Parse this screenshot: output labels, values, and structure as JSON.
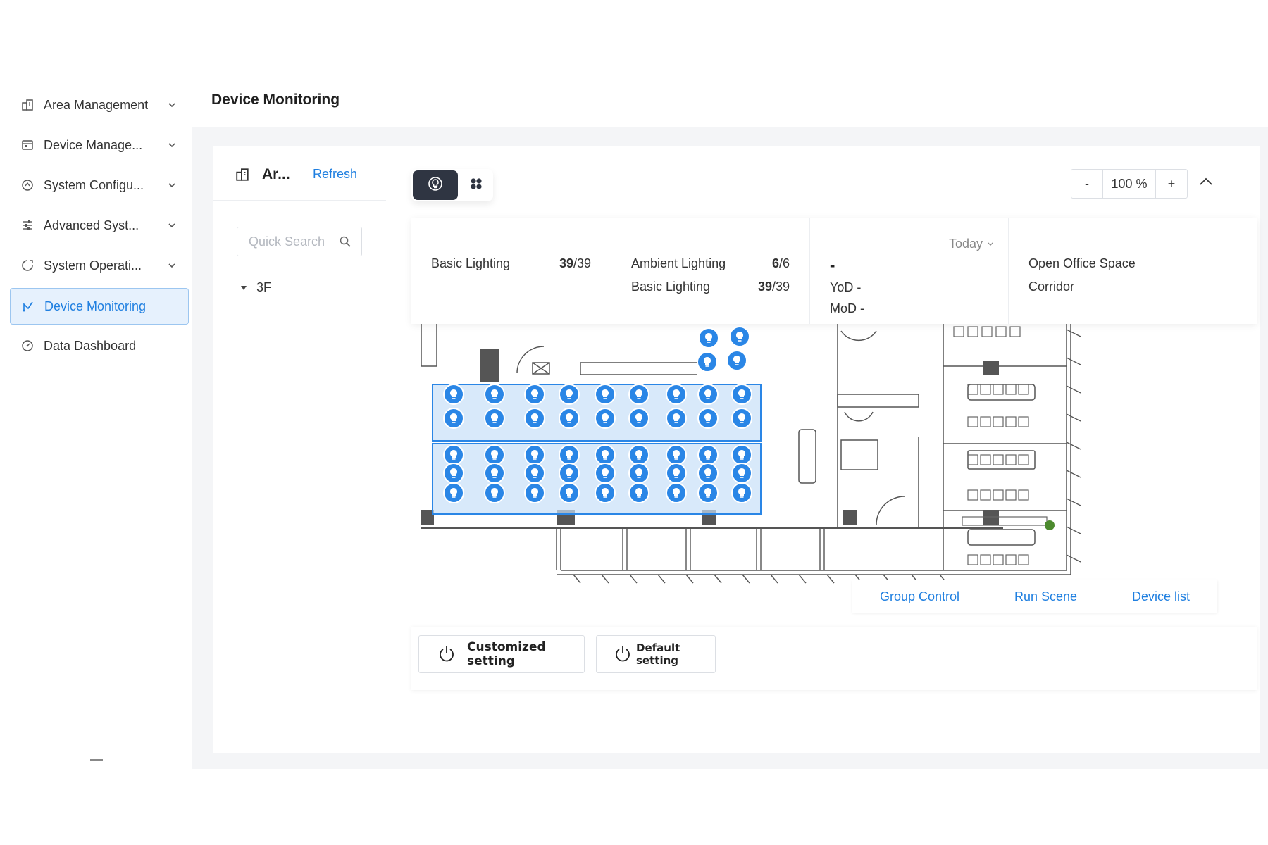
{
  "sidebar": {
    "items": [
      {
        "label": "Area Management",
        "icon": "building-icon"
      },
      {
        "label": "Device Manage...",
        "icon": "device-box-icon"
      },
      {
        "label": "System Configu...",
        "icon": "settings-circle-icon"
      },
      {
        "label": "Advanced Syst...",
        "icon": "sliders-icon"
      },
      {
        "label": "System Operati...",
        "icon": "operation-icon"
      },
      {
        "label": "Device Monitoring",
        "icon": "monitor-signal-icon",
        "active": true
      },
      {
        "label": "Data Dashboard",
        "icon": "dashboard-gauge-icon"
      }
    ]
  },
  "header": {
    "title": "Device Monitoring"
  },
  "area_panel": {
    "title": "Ar...",
    "refresh": "Refresh",
    "search_placeholder": "Quick Search",
    "tree": [
      {
        "label": "3F",
        "expanded": true
      }
    ]
  },
  "toolbar": {
    "views": [
      "lightbulb-view",
      "grid-view"
    ],
    "zoom_minus": "-",
    "zoom_value": "100 %",
    "zoom_plus": "+"
  },
  "stats": {
    "card1": {
      "label": "Basic Lighting",
      "value": "39",
      "total": "/39"
    },
    "card2": {
      "rows": [
        {
          "label": "Ambient Lighting",
          "value": "6",
          "total": "/6"
        },
        {
          "label": "Basic Lighting",
          "value": "39",
          "total": "/39"
        }
      ]
    },
    "card3": {
      "period": "Today",
      "value": "-",
      "yod": "YoD -",
      "mod": "MoD -"
    },
    "card4": {
      "items": [
        "Open Office Space",
        "Corridor"
      ]
    }
  },
  "floorplan": {
    "top_lights": 4,
    "zone_top_lights": 18,
    "zone_bottom_lights": 27
  },
  "actions": [
    "Group Control",
    "Run Scene",
    "Device list"
  ],
  "settings": {
    "customized": "Customized setting",
    "default": "Default setting"
  },
  "colors": {
    "accent": "#1f7fe0",
    "light_marker": "#2a86e6",
    "zone_fill": "#c7e0f8",
    "zone_border": "#2a86e6",
    "active_toggle": "#2f3542"
  }
}
